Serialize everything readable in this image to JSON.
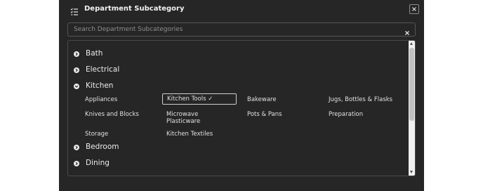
{
  "dialog": {
    "title": "Department Subcategory",
    "icons": {
      "header": "checklist-icon",
      "close": "close-icon",
      "clear": "clear-x-icon"
    }
  },
  "search": {
    "placeholder": "Search Department Subcategories",
    "value": ""
  },
  "categories": [
    {
      "label": "Bath",
      "expanded": false
    },
    {
      "label": "Electrical",
      "expanded": false
    },
    {
      "label": "Kitchen",
      "expanded": true
    },
    {
      "label": "Bedroom",
      "expanded": false
    },
    {
      "label": "Dining",
      "expanded": false
    }
  ],
  "kitchen_subcategories": [
    {
      "label": "Appliances",
      "selected": false
    },
    {
      "label": "Kitchen Tools ✓",
      "selected": true
    },
    {
      "label": "Bakeware",
      "selected": false
    },
    {
      "label": "Jugs, Bottles & Flasks",
      "selected": false
    },
    {
      "label": "Knives and Blocks",
      "selected": false
    },
    {
      "label": "Microwave Plasticware",
      "selected": false
    },
    {
      "label": "Pots & Pans",
      "selected": false
    },
    {
      "label": "Preparation",
      "selected": false
    },
    {
      "label": "Storage",
      "selected": false
    },
    {
      "label": "Kitchen Textiles",
      "selected": false
    }
  ]
}
